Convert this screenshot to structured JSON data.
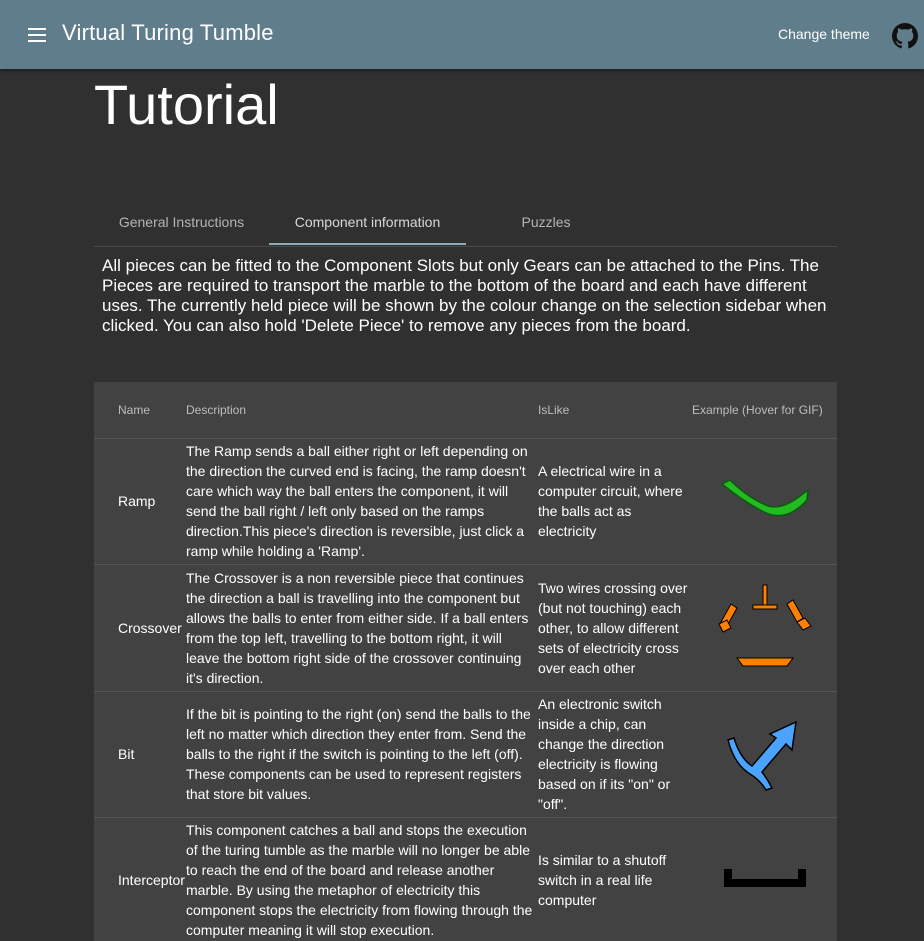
{
  "appbar": {
    "title": "Virtual Turing Tumble",
    "theme_button": "Change theme",
    "menu_icon": "menu-icon",
    "github_icon": "github-icon",
    "color": "#607d8b"
  },
  "page": {
    "title": "Tutorial"
  },
  "tabs": [
    {
      "label": "General Instructions",
      "active": false
    },
    {
      "label": "Component information",
      "active": true
    },
    {
      "label": "Puzzles",
      "active": false
    }
  ],
  "intro": "All pieces can be fitted to the Component Slots but only Gears can be attached to the Pins. The Pieces are required to transport the marble to the bottom of the board and each have different uses. The currently held piece will be shown by the colour change on the selection sidebar when clicked. You can also hold 'Delete Piece' to remove any pieces from the board.",
  "table": {
    "headers": {
      "name": "Name",
      "description": "Description",
      "islike": "IsLike",
      "example": "Example (Hover for GIF)"
    },
    "rows": [
      {
        "name": "Ramp",
        "description": "The Ramp sends a ball either right or left depending on the direction the curved end is facing, the ramp doesn't care which way the ball enters the component, it will send the ball right / left only based on the ramps direction.This piece's direction is reversible, just click a ramp while holding a 'Ramp'.",
        "islike": "A electrical wire in a computer circuit, where the balls act as electricity",
        "icon": "ramp-icon",
        "color": "#22bb22"
      },
      {
        "name": "Crossover",
        "description": "The Crossover is a non reversible piece that continues the direction a ball is travelling into the component but allows the balls to enter from either side. If a ball enters from the top left, travelling to the bottom right, it will leave the bottom right side of the crossover continuing it's direction.",
        "islike": "Two wires crossing over (but not touching) each other, to allow different sets of electricity cross over each other",
        "icon": "crossover-icon",
        "color": "#ff7f00"
      },
      {
        "name": "Bit",
        "description": "If the bit is pointing to the right (on) send the balls to the left no matter which direction they enter from. Send the balls to the right if the switch is pointing to the left (off). These components can be used to represent registers that store bit values.",
        "islike": "An electronic switch inside a chip, can change the direction electricity is flowing based on if its \"on\" or \"off\".",
        "icon": "bit-icon",
        "color": "#4aa3ff"
      },
      {
        "name": "Interceptor",
        "description": "This component catches a ball and stops the execution of the turing tumble as the marble will no longer be able to reach the end of the board and release another marble. By using the metaphor of electricity this component stops the electricity from flowing through the computer meaning it will stop execution.",
        "islike": "Is similar to a shutoff switch in a real life computer",
        "icon": "interceptor-icon",
        "color": "#000000"
      }
    ]
  }
}
